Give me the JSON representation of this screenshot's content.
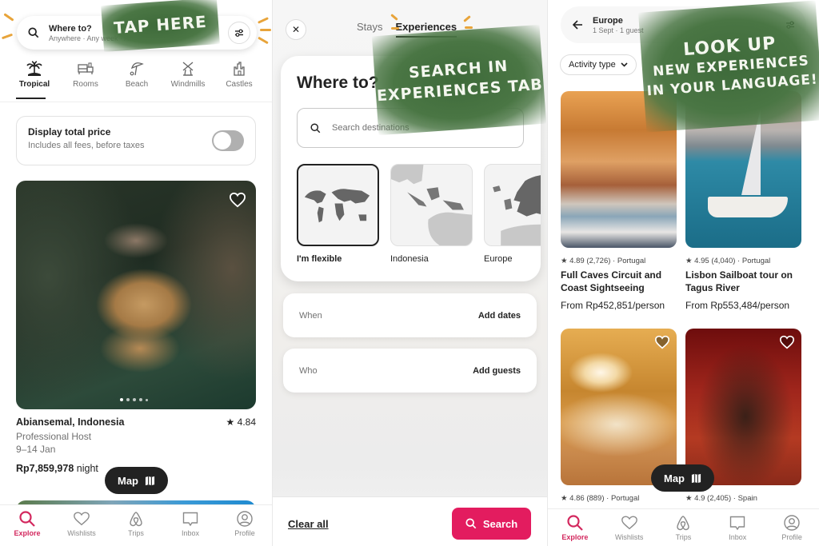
{
  "panel1": {
    "search": {
      "title": "Where to?",
      "subtitle": "Anywhere · Any week · Add guests"
    },
    "categories": [
      {
        "label": "Tropical",
        "icon": "palm-tree-icon",
        "active": true
      },
      {
        "label": "Rooms",
        "icon": "bed-icon",
        "active": false
      },
      {
        "label": "Beach",
        "icon": "umbrella-icon",
        "active": false
      },
      {
        "label": "Windmills",
        "icon": "windmill-icon",
        "active": false
      },
      {
        "label": "Castles",
        "icon": "castle-icon",
        "active": false
      }
    ],
    "price_toggle": {
      "title": "Display total price",
      "subtitle": "Includes all fees, before taxes",
      "on": false
    },
    "listing": {
      "title": "Abiansemal, Indonesia",
      "rating": "4.84",
      "host": "Professional Host",
      "dates": "9–14 Jan",
      "price": "Rp7,859,978",
      "price_unit": "night",
      "photo_count": 5,
      "photo_index": 1
    },
    "map_button": "Map",
    "annotation": "TAP HERE"
  },
  "panel2": {
    "tabs": [
      {
        "label": "Stays",
        "active": false
      },
      {
        "label": "Experiences",
        "active": true
      }
    ],
    "heading": "Where to?",
    "search_placeholder": "Search destinations",
    "regions": [
      {
        "label": "I'm flexible",
        "active": true
      },
      {
        "label": "Indonesia",
        "active": false
      },
      {
        "label": "Europe",
        "active": false
      }
    ],
    "when": {
      "label": "When",
      "value": "Add dates"
    },
    "who": {
      "label": "Who",
      "value": "Add guests"
    },
    "clear_all": "Clear all",
    "search_button": "Search",
    "annotation_line1": "SEARCH IN",
    "annotation_line2": "EXPERIENCES TAB"
  },
  "panel3": {
    "header": {
      "title": "Europe",
      "subtitle": "1 Sept · 1 guest"
    },
    "chips": [
      {
        "label": "Activity type"
      }
    ],
    "experiences": [
      {
        "rating": "4.89",
        "reviews": "(2,726)",
        "country": "Portugal",
        "title": "Full Caves Circuit and Coast Sightseeing",
        "price": "From Rp452,851/person"
      },
      {
        "rating": "4.95",
        "reviews": "(4,040)",
        "country": "Portugal",
        "title": "Lisbon Sailboat tour on Tagus River",
        "price": "From Rp553,484/person"
      },
      {
        "rating": "4.86",
        "reviews": "(889)",
        "country": "Portugal"
      },
      {
        "rating": "4.9",
        "reviews": "(2,405)",
        "country": "Spain"
      }
    ],
    "map_button": "Map",
    "annotation_line1": "LOOK UP",
    "annotation_line2": "NEW EXPERIENCES",
    "annotation_line3": "IN YOUR LANGUAGE!"
  },
  "tabbar": [
    {
      "label": "Explore",
      "icon": "search-icon",
      "active": true
    },
    {
      "label": "Wishlists",
      "icon": "heart-icon",
      "active": false
    },
    {
      "label": "Trips",
      "icon": "airbnb-logo-icon",
      "active": false
    },
    {
      "label": "Inbox",
      "icon": "message-icon",
      "active": false
    },
    {
      "label": "Profile",
      "icon": "profile-icon",
      "active": false
    }
  ],
  "colors": {
    "accent": "#e31c5f",
    "explore_active": "#d3285e",
    "paint": "#4a7644",
    "dash": "#e8a43a"
  }
}
